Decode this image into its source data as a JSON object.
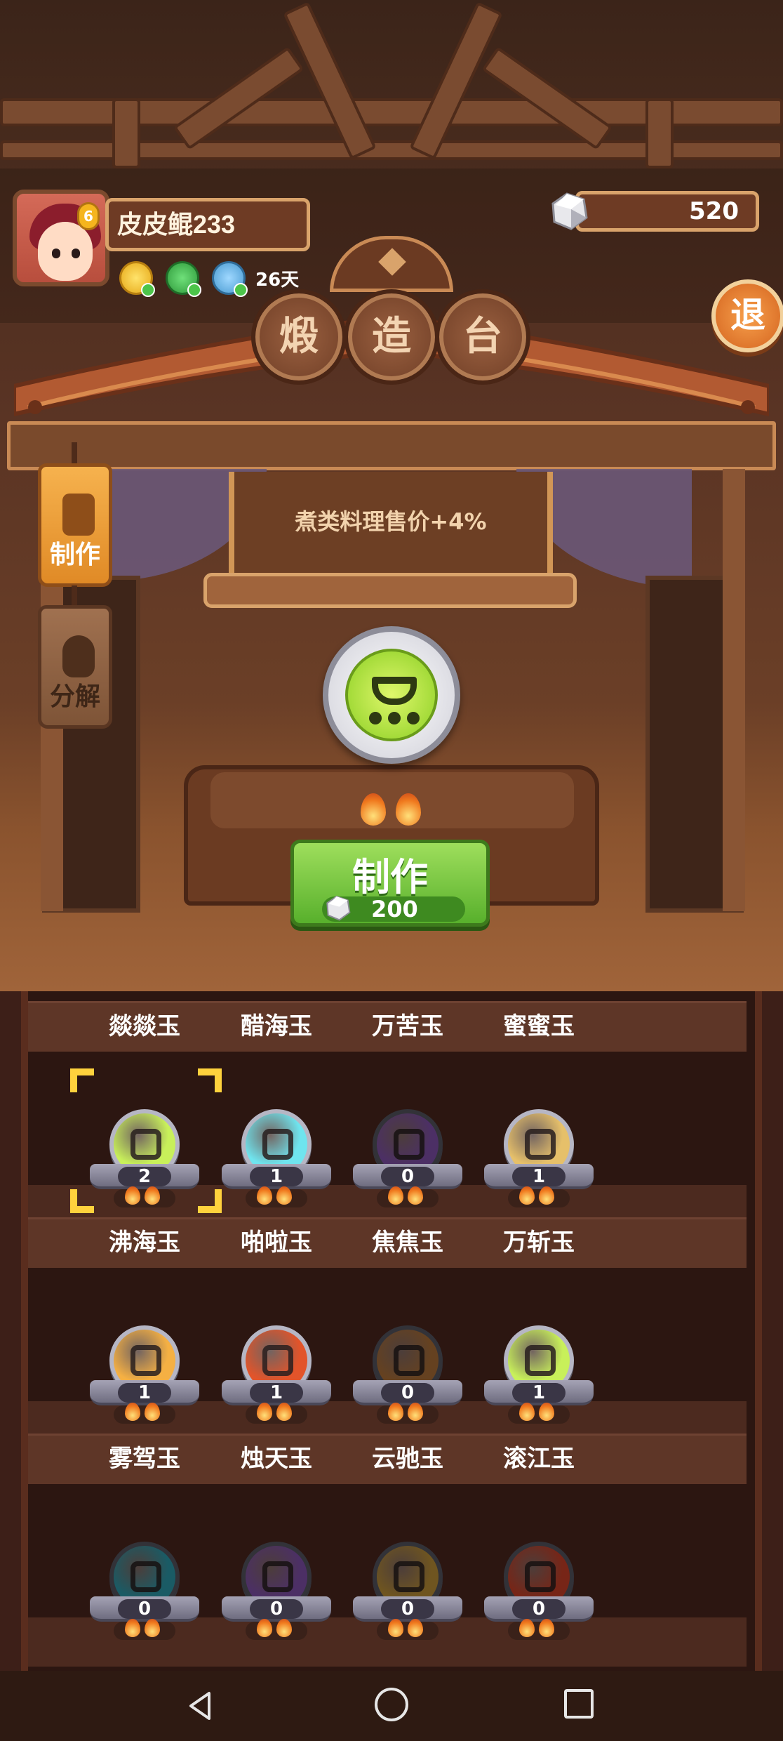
{
  "player": {
    "name": "皮皮鲲233",
    "days": "26天"
  },
  "currency": {
    "amount": "520",
    "icon": "stone-icon"
  },
  "exit_label": "退",
  "title_chars": [
    "煅",
    "造",
    "台"
  ],
  "side_tabs": {
    "make": "制作",
    "decompose": "分解"
  },
  "bonus_text": "煮类料理售价+4%",
  "make_button": {
    "label": "制作",
    "cost": "200"
  },
  "selected_heat": 2,
  "items": [
    {
      "name": "燚燚玉",
      "count": "2",
      "color": "#c8f05a",
      "locked": false,
      "selected": true
    },
    {
      "name": "醋海玉",
      "count": "1",
      "color": "#6fe4ee",
      "locked": false,
      "selected": false
    },
    {
      "name": "万苦玉",
      "count": "0",
      "color": "#8a56b8",
      "locked": true,
      "selected": false
    },
    {
      "name": "蜜蜜玉",
      "count": "1",
      "color": "#e6c06a",
      "locked": false,
      "selected": false
    },
    {
      "name": "沸海玉",
      "count": "1",
      "color": "#f5b043",
      "locked": false,
      "selected": false
    },
    {
      "name": "啪啦玉",
      "count": "1",
      "color": "#e2542a",
      "locked": false,
      "selected": false
    },
    {
      "name": "焦焦玉",
      "count": "0",
      "color": "#b8773a",
      "locked": true,
      "selected": false
    },
    {
      "name": "万斩玉",
      "count": "1",
      "color": "#c8f05a",
      "locked": false,
      "selected": false
    },
    {
      "name": "雾驾玉",
      "count": "0",
      "color": "#2fa6b8",
      "locked": true,
      "selected": false
    },
    {
      "name": "烛天玉",
      "count": "0",
      "color": "#8a56b8",
      "locked": true,
      "selected": false
    },
    {
      "name": "云驰玉",
      "count": "0",
      "color": "#c99a3a",
      "locked": true,
      "selected": false
    },
    {
      "name": "滚江玉",
      "count": "0",
      "color": "#d8442a",
      "locked": true,
      "selected": false
    }
  ]
}
